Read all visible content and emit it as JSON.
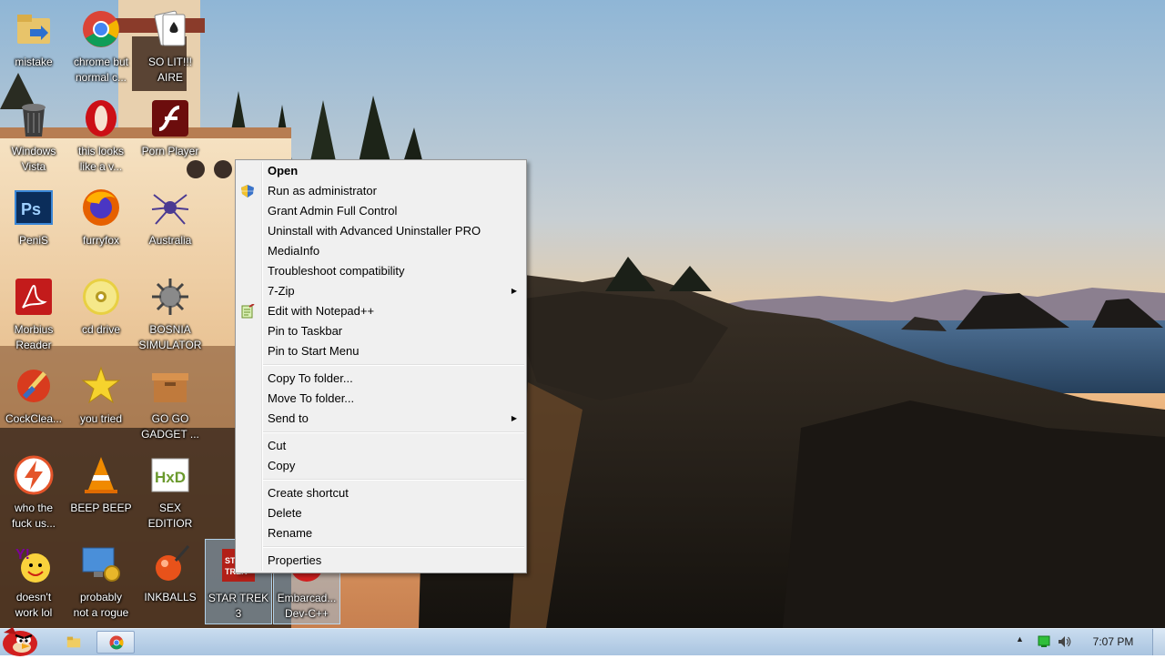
{
  "desktop_icons": [
    {
      "label": "mistake",
      "icon": "folder-arrow-icon"
    },
    {
      "label": "chrome but\nnormal c...",
      "icon": "chrome-icon"
    },
    {
      "label": "SO LIT!!!\nAIRE",
      "icon": "playing-cards-icon"
    },
    {
      "label": "Windows\nVista",
      "icon": "recycle-bin-icon"
    },
    {
      "label": "this looks\nlike a v...",
      "icon": "opera-icon"
    },
    {
      "label": "Porn Player",
      "icon": "flash-icon"
    },
    {
      "label": "PeniS",
      "icon": "photoshop-icon"
    },
    {
      "label": "furryfox",
      "icon": "firefox-icon"
    },
    {
      "label": "Australia",
      "icon": "spider-solitaire-icon"
    },
    {
      "label": "Morbius\nReader",
      "icon": "acrobat-reader-icon"
    },
    {
      "label": "cd drive",
      "icon": "cd-drive-icon"
    },
    {
      "label": "BOSNIA\nSIMULATOR",
      "icon": "spiked-mine-icon"
    },
    {
      "label": "CockClea...",
      "icon": "ccleaner-icon"
    },
    {
      "label": "you tried",
      "icon": "star-icon"
    },
    {
      "label": "GO GO\nGADGET ...",
      "icon": "gadget-box-icon"
    },
    {
      "label": "who the\nfuck us...",
      "icon": "lightning-icon"
    },
    {
      "label": "BEEP BEEP",
      "icon": "vlc-cone-icon"
    },
    {
      "label": "SEX\nEDITIOR",
      "icon": "hxd-editor-icon"
    },
    {
      "label": "doesn't\nwork lol",
      "icon": "yahoo-messenger-icon"
    },
    {
      "label": "probably\nnot a rogue",
      "icon": "monitor-gears-icon"
    },
    {
      "label": "INKBALLS",
      "icon": "inkball-icon"
    },
    {
      "label": "STAR TREK\n3",
      "icon": "star-trek-icon"
    },
    {
      "label": "Embarcad...\nDev-C++",
      "icon": "devcpp-icon"
    }
  ],
  "context_menu": {
    "groups": [
      [
        {
          "label": "Open",
          "bold": true
        },
        {
          "label": "Run as administrator",
          "icon": "uac-shield-icon"
        },
        {
          "label": "Grant Admin Full Control"
        },
        {
          "label": "Uninstall with Advanced Uninstaller PRO"
        },
        {
          "label": "MediaInfo"
        },
        {
          "label": "Troubleshoot compatibility"
        },
        {
          "label": "7-Zip",
          "submenu": true
        },
        {
          "label": "Edit with Notepad++",
          "icon": "notepadpp-icon"
        },
        {
          "label": "Pin to Taskbar"
        },
        {
          "label": "Pin to Start Menu"
        }
      ],
      [
        {
          "label": "Copy To folder..."
        },
        {
          "label": "Move To folder..."
        },
        {
          "label": "Send to",
          "submenu": true
        }
      ],
      [
        {
          "label": "Cut"
        },
        {
          "label": "Copy"
        }
      ],
      [
        {
          "label": "Create shortcut"
        },
        {
          "label": "Delete"
        },
        {
          "label": "Rename"
        }
      ],
      [
        {
          "label": "Properties"
        }
      ]
    ]
  },
  "taskbar": {
    "pinned": [
      {
        "icon": "explorer-folder-icon",
        "active": false
      },
      {
        "icon": "chrome-icon",
        "active": true
      }
    ],
    "tray_icons": [
      "network-icon",
      "volume-icon"
    ],
    "clock": "7:07 PM"
  },
  "colors": {
    "menu_bg": "#f0f0f0",
    "taskbar": "#b8cfe6",
    "selection": "#99c9ef"
  }
}
